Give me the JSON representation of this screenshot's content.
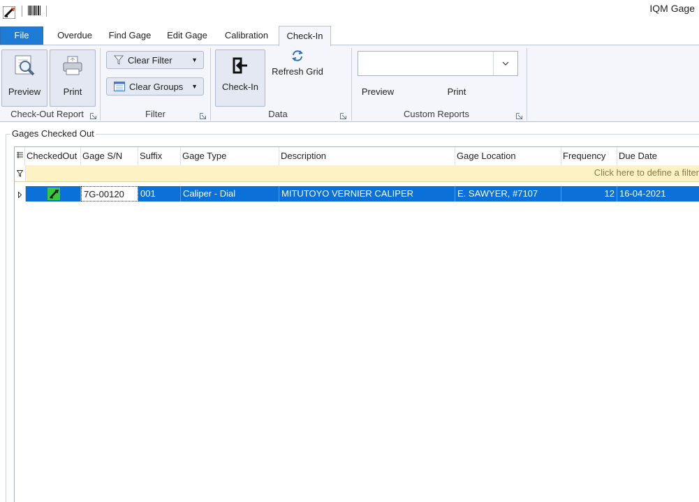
{
  "app": {
    "title": "IQM Gage"
  },
  "tabs": [
    "File",
    "Overdue",
    "Find Gage",
    "Edit Gage",
    "Calibration",
    "Check-In"
  ],
  "ribbon": {
    "checkout_report": {
      "preview": "Preview",
      "print": "Print",
      "label": "Check-Out Report"
    },
    "filter": {
      "clear_filter": "Clear Filter",
      "clear_groups": "Clear Groups",
      "label": "Filter"
    },
    "data": {
      "check_in": "Check-In",
      "refresh_grid": "Refresh Grid",
      "label": "Data"
    },
    "custom_reports": {
      "combo_value": "",
      "preview": "Preview",
      "print": "Print",
      "label": "Custom Reports"
    }
  },
  "panel": {
    "title": "Gages Checked Out"
  },
  "grid": {
    "columns": [
      "CheckedOut",
      "Gage S/N",
      "Suffix",
      "Gage Type",
      "Description",
      "Gage Location",
      "Frequency",
      "Due Date"
    ],
    "filter_prompt": "Click here to define a filter",
    "rows": [
      {
        "checked_out_icon": "gage-checked-out-icon",
        "gage_sn": "7G-00120",
        "suffix": "001",
        "gage_type": "Caliper - Dial",
        "description": "MITUTOYO VERNIER CALIPER",
        "location": "E. SAWYER, #7107",
        "frequency": "12",
        "due_date": "16-04-2021"
      }
    ]
  },
  "colors": {
    "selection": "#0b70d7",
    "file_tab": "#1e7bd6",
    "filter_row": "#fdf2c3",
    "check_icon": "#37c93b"
  }
}
